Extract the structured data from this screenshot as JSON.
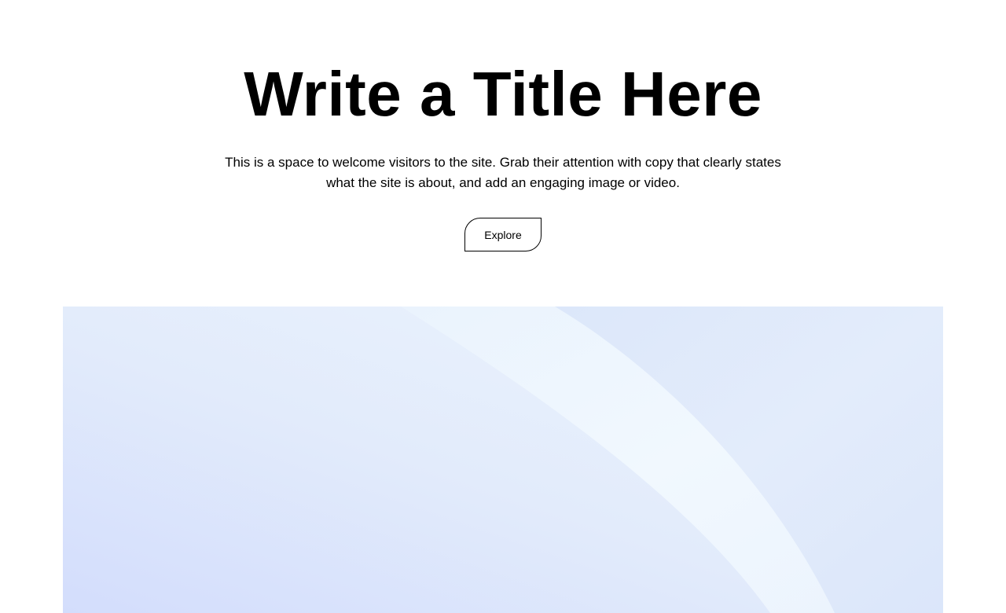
{
  "hero": {
    "title": "Write a Title Here",
    "subtitle": "This is a space to welcome visitors to the site. Grab their attention with copy that clearly states what the site is about, and add an engaging image or video.",
    "button_label": "Explore"
  },
  "media": {
    "colors": {
      "base_left": "#d5e0fd",
      "base_mid": "#eef6fd",
      "curve_band": "#f0f8fe",
      "right_panel": "#dfe9fa"
    }
  }
}
